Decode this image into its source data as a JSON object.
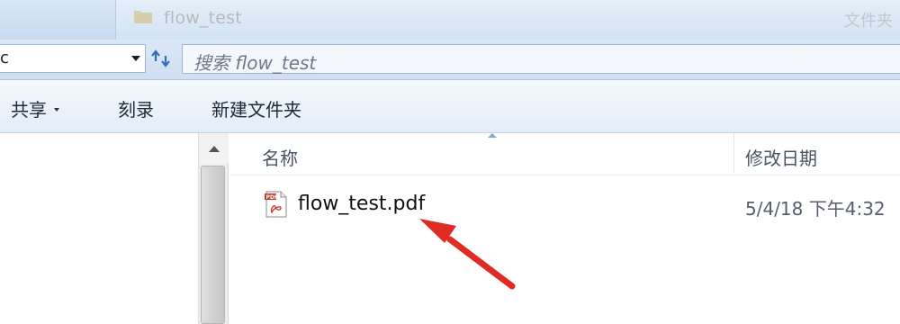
{
  "window": {
    "folder_name": "flow_test",
    "folder_type": "文件夹"
  },
  "address": {
    "current_path_fragment": "c",
    "search_placeholder": "搜索 flow_test"
  },
  "toolbar": {
    "share_label": "共享",
    "burn_label": "刻录",
    "new_folder_label": "新建文件夹"
  },
  "columns": {
    "name_header": "名称",
    "date_header": "修改日期"
  },
  "files": [
    {
      "name": "flow_test.pdf",
      "modified": "5/4/18 下午4:32",
      "icon": "pdf-file-icon"
    }
  ],
  "icons": {
    "folder": "folder-icon",
    "dropdown": "chevron-down-icon",
    "refresh": "refresh-icon",
    "share_caret": "chevron-down-icon",
    "scroll_up": "arrow-up-icon",
    "sort": "sort-ascending-icon",
    "annotation": "red-arrow-annotation"
  },
  "colors": {
    "annotation_red": "#e02a24",
    "chrome_blue": "#d3e3f3",
    "pdf_red": "#c0392b"
  }
}
